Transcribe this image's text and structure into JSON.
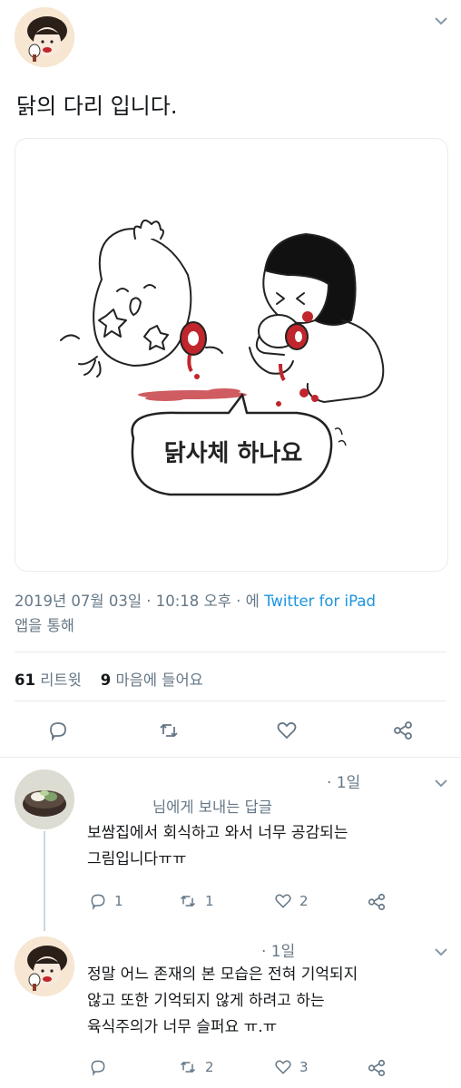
{
  "tweet": {
    "text": "닭의 다리 입니다.",
    "image_caption": "닭사체 하나요",
    "timestamp": "2019년 07월 03일 · 10:18 오후 · 에",
    "client": "Twitter for iPad",
    "client_suffix": "앱을 통해",
    "retweet_count": "61",
    "retweet_label": "리트윗",
    "like_count": "9",
    "like_label": "마음에 들어요"
  },
  "replies": [
    {
      "time": "· 1일",
      "replying_to": "님에게 보내는 답글",
      "line1": "보쌈집에서 회식하고 와서 너무 공감되는",
      "line2": "그림입니다ㅠㅠ",
      "reply_count": "1",
      "retweet_count": "1",
      "like_count": "2"
    },
    {
      "time": "· 1일",
      "line1": "정말 어느 존재의 본 모습은 전혀 기억되지",
      "line2": "않고 또한 기억되지 않게 하려고 하는",
      "line3": "육식주의가 너무 슬퍼요 ㅠ.ㅠ",
      "retweet_count": "2",
      "like_count": "3"
    }
  ],
  "icons": {
    "chevron": "chevron-down-icon",
    "reply": "reply-icon",
    "retweet": "retweet-icon",
    "like": "heart-icon",
    "share": "share-icon"
  },
  "colors": {
    "link": "#1b95e0",
    "muted": "#657786",
    "blood": "#c0262c"
  }
}
